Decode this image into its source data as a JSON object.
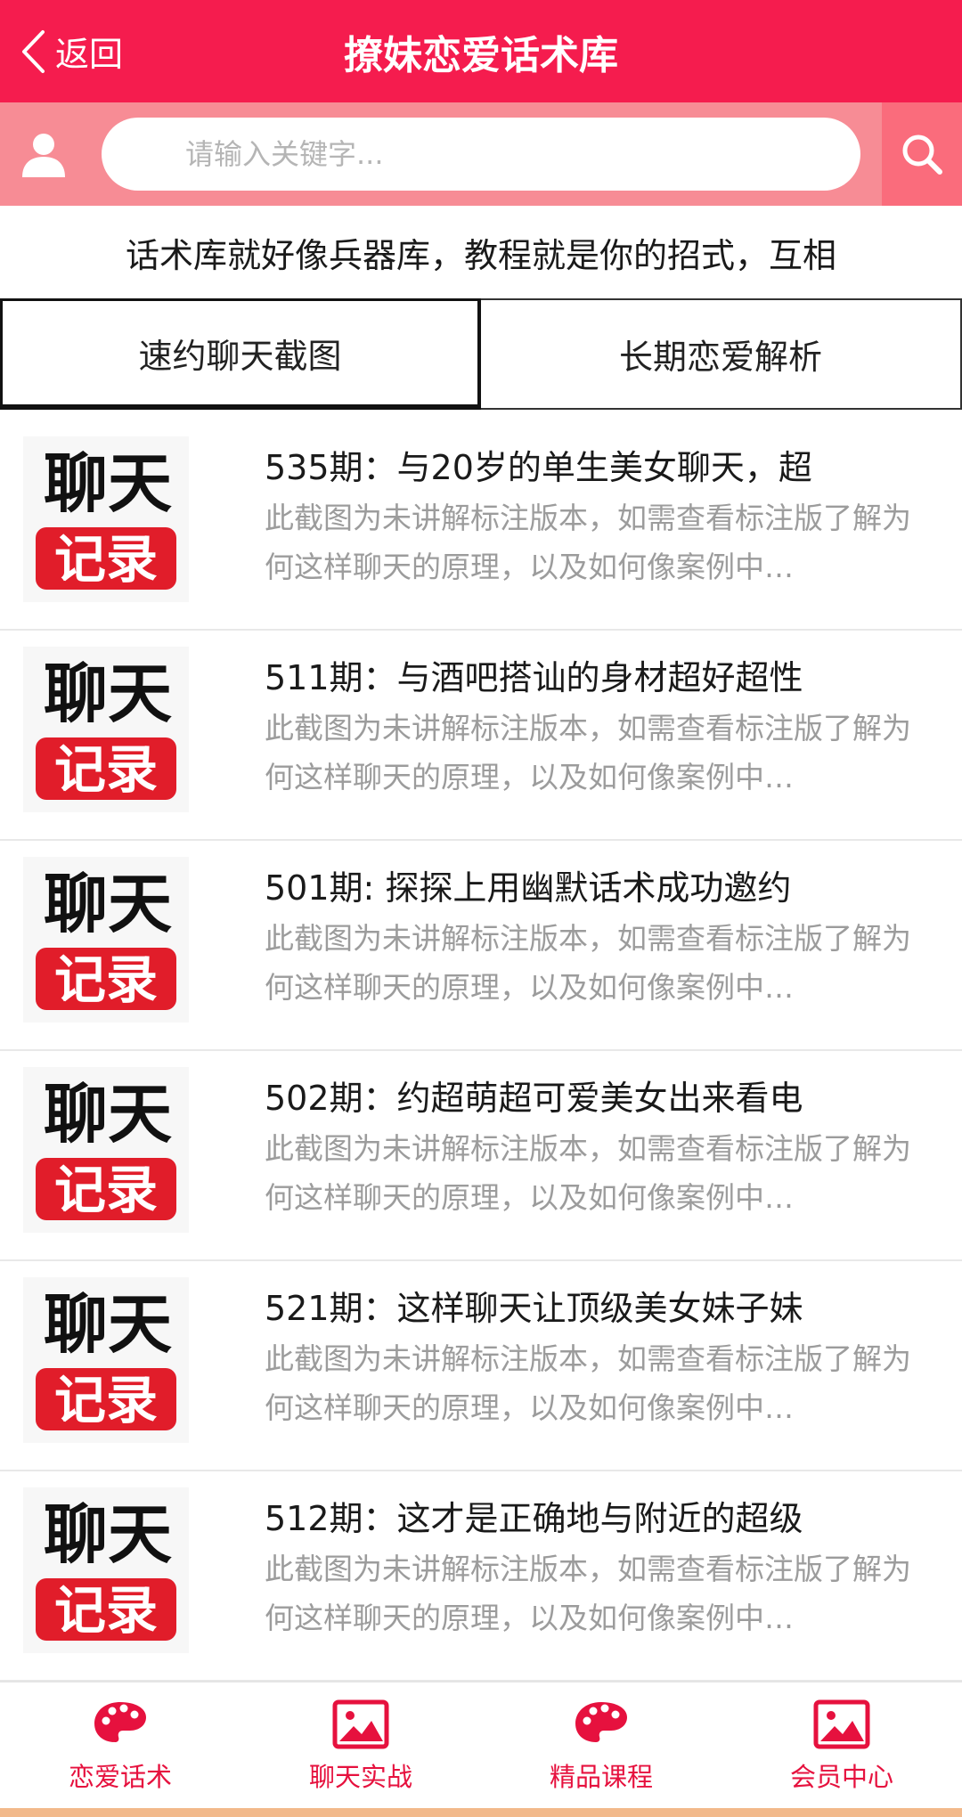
{
  "header": {
    "back_label": "返回",
    "title": "撩妹恋爱话术库"
  },
  "search": {
    "placeholder": "请输入关键字..."
  },
  "intro": "话术库就好像兵器库，教程就是你的招式，互相",
  "tabs": [
    {
      "label": "速约聊天截图",
      "active": true
    },
    {
      "label": "长期恋爱解析",
      "active": false
    }
  ],
  "thumbnail": {
    "top_text": "聊天",
    "bottom_text": "记录"
  },
  "items": [
    {
      "title": "535期：与20岁的单生美女聊天，超",
      "desc": "此截图为未讲解标注版本，如需查看标注版了解为何这样聊天的原理，以及如何像案例中…"
    },
    {
      "title": "511期：与酒吧搭讪的身材超好超性",
      "desc": "此截图为未讲解标注版本，如需查看标注版了解为何这样聊天的原理，以及如何像案例中…"
    },
    {
      "title": "501期: 探探上用幽默话术成功邀约",
      "desc": "此截图为未讲解标注版本，如需查看标注版了解为何这样聊天的原理，以及如何像案例中…"
    },
    {
      "title": "502期：约超萌超可爱美女出来看电",
      "desc": "此截图为未讲解标注版本，如需查看标注版了解为何这样聊天的原理，以及如何像案例中…"
    },
    {
      "title": "521期：这样聊天让顶级美女妹子妹",
      "desc": "此截图为未讲解标注版本，如需查看标注版了解为何这样聊天的原理，以及如何像案例中…"
    },
    {
      "title": "512期：这才是正确地与附近的超级",
      "desc": "此截图为未讲解标注版本，如需查看标注版了解为何这样聊天的原理，以及如何像案例中…"
    }
  ],
  "nav": [
    {
      "label": "恋爱话术",
      "icon": "palette-icon"
    },
    {
      "label": "聊天实战",
      "icon": "picture-icon"
    },
    {
      "label": "精品课程",
      "icon": "palette-icon"
    },
    {
      "label": "会员中心",
      "icon": "picture-icon"
    }
  ],
  "colors": {
    "primary": "#f51c4e",
    "search_bar": "#f78c95",
    "nav_active": "#e6113e"
  }
}
